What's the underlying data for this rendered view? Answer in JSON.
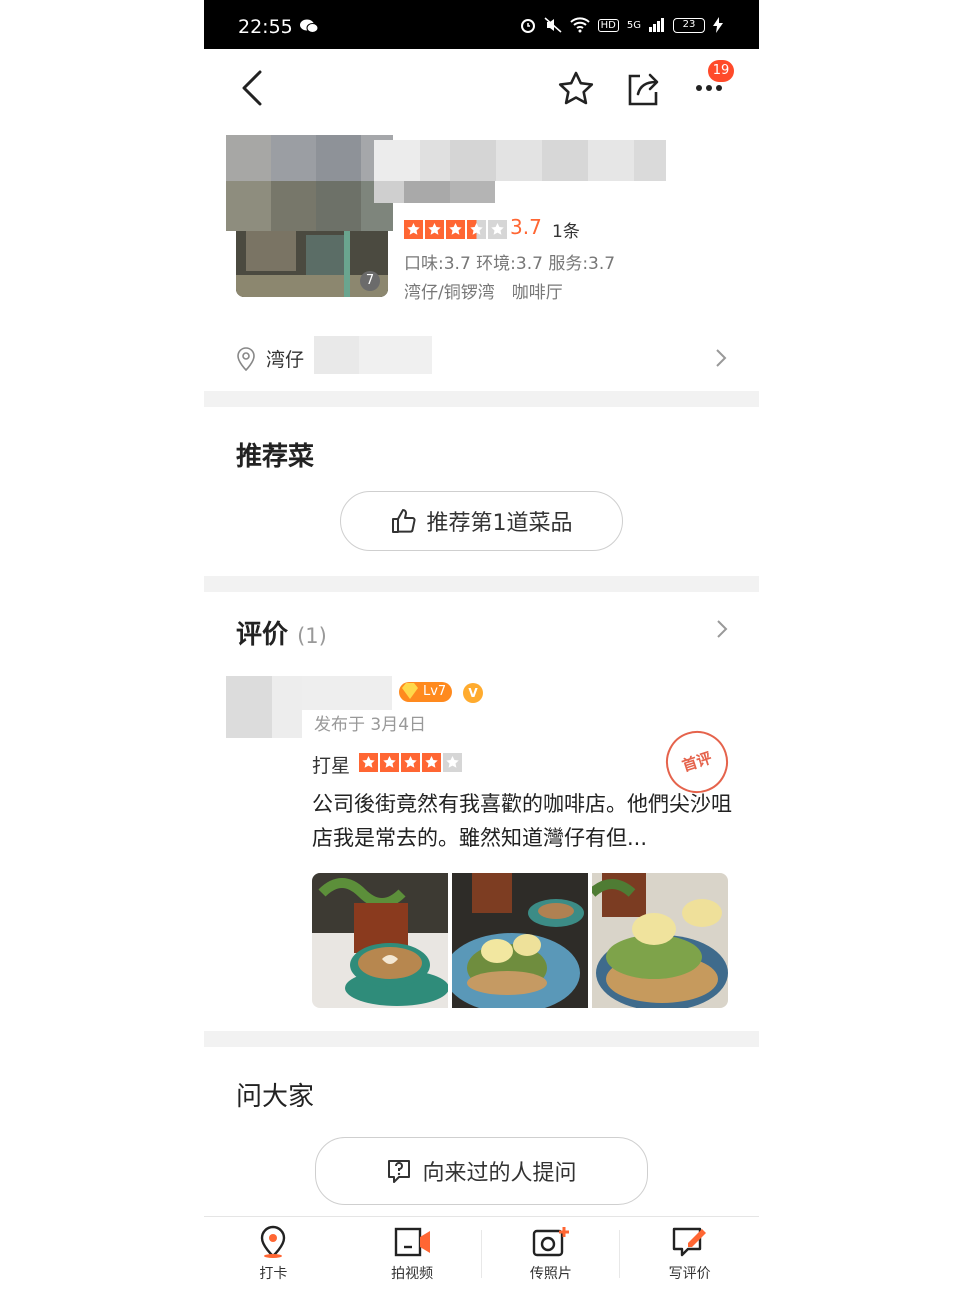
{
  "status_bar": {
    "time": "22:55",
    "battery": "23",
    "network": "5G"
  },
  "nav": {
    "message_count": "19"
  },
  "shop": {
    "photo_count": "7",
    "rating_score": "3.7",
    "review_count": "1条",
    "sub_scores": "口味:3.7 环境:3.7 服务:3.7",
    "area_category": "湾仔/铜锣湾　咖啡厅",
    "address_partial": "湾仔",
    "stars": {
      "value": 3.5,
      "max": 5
    }
  },
  "recommend": {
    "title": "推荐菜",
    "button_label": "推荐第1道菜品"
  },
  "reviews": {
    "title": "评价",
    "count": "(1)",
    "item": {
      "level": "Lv7",
      "verified_badge": "V",
      "posted": "发布于 3月4日",
      "star_label": "打星",
      "stars": {
        "value": 4,
        "max": 5
      },
      "stamp": "首评",
      "text": "公司後街竟然有我喜歡的咖啡店。他們尖沙咀店我是常去的。雖然知道灣仔有但..."
    }
  },
  "ask": {
    "title": "问大家",
    "button_label": "向来过的人提问"
  },
  "tabbar": {
    "items": [
      {
        "label": "打卡",
        "icon": "location-pin-icon"
      },
      {
        "label": "拍视频",
        "icon": "video-camera-icon"
      },
      {
        "label": "传照片",
        "icon": "photo-upload-icon"
      },
      {
        "label": "写评价",
        "icon": "write-review-icon"
      }
    ]
  },
  "colors": {
    "accent": "#ff6633",
    "badge": "#ff4a2a",
    "divider": "#f2f2f2"
  }
}
